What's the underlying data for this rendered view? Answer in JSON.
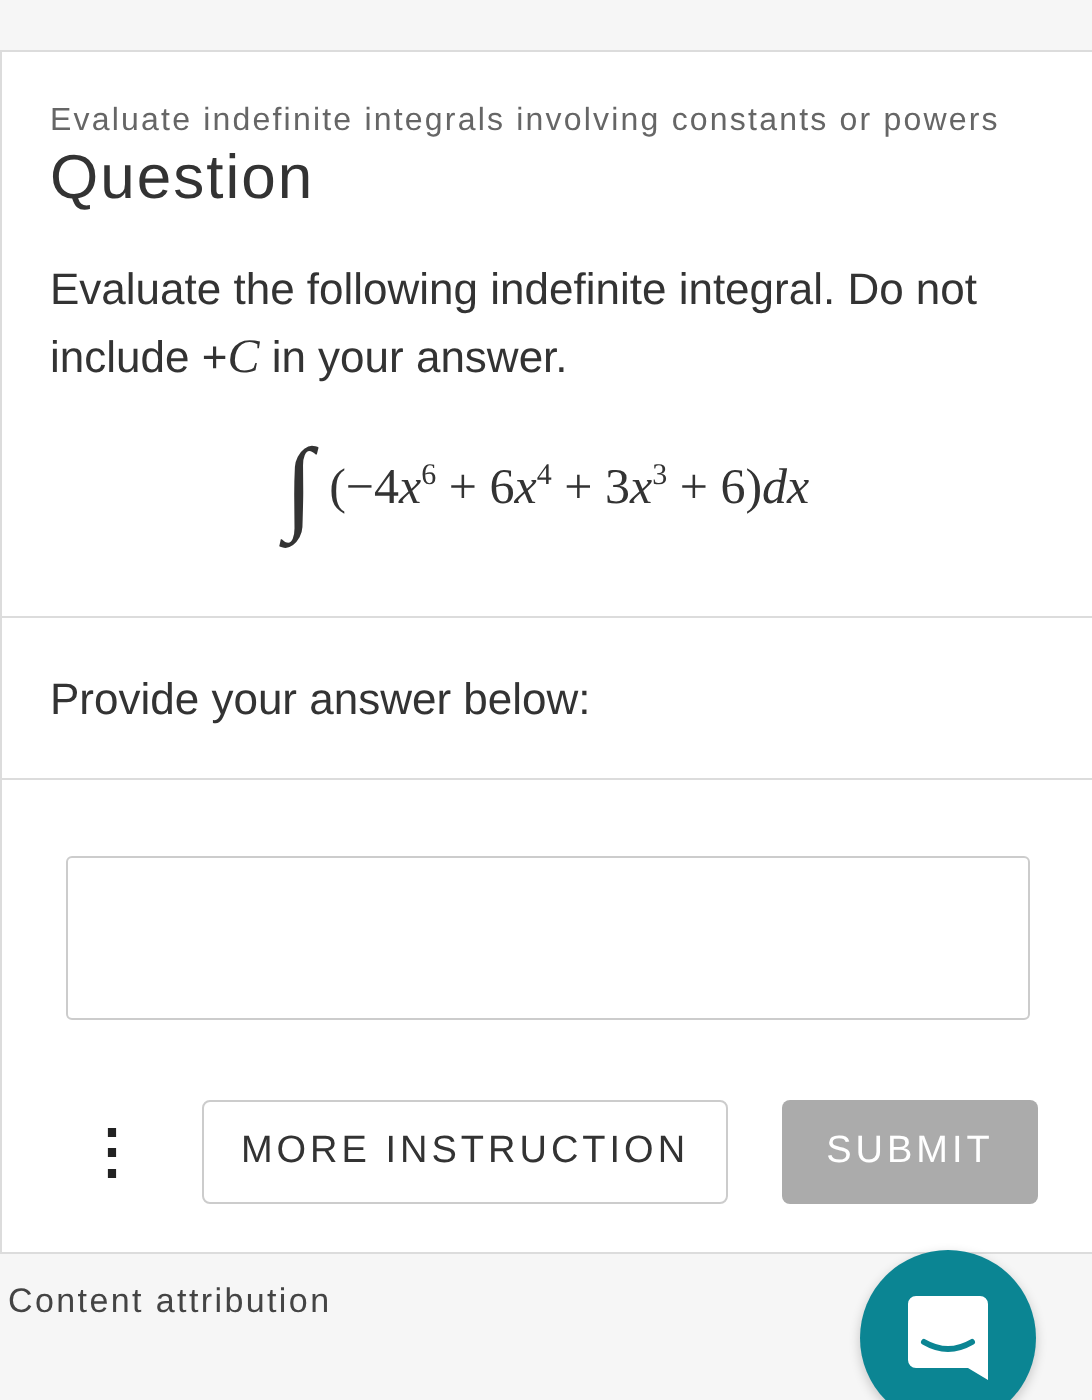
{
  "topic": "Evaluate indefinite integrals involving constants or powers",
  "heading": "Question",
  "prompt": "Evaluate the following indefinite integral. Do not include +*C* in your answer.",
  "integral_sign": "∫",
  "integrand": [
    {
      "kind": "text",
      "text": "(−4"
    },
    {
      "kind": "var",
      "text": "x"
    },
    {
      "kind": "sup",
      "text": "6"
    },
    {
      "kind": "text",
      "text": " + 6"
    },
    {
      "kind": "var",
      "text": "x"
    },
    {
      "kind": "sup",
      "text": "4"
    },
    {
      "kind": "text",
      "text": " + 3"
    },
    {
      "kind": "var",
      "text": "x"
    },
    {
      "kind": "sup",
      "text": "3"
    },
    {
      "kind": "text",
      "text": " + 6)"
    },
    {
      "kind": "var",
      "text": "dx"
    }
  ],
  "answer_label": "Provide your answer below:",
  "more_menu": "⋮",
  "buttons": [
    {
      "label": "MORE INSTRUCTION",
      "kind": "outline",
      "disabled": false
    },
    {
      "label": "SUBMIT",
      "kind": "primary",
      "disabled": true
    }
  ],
  "footer": "Content attribution"
}
